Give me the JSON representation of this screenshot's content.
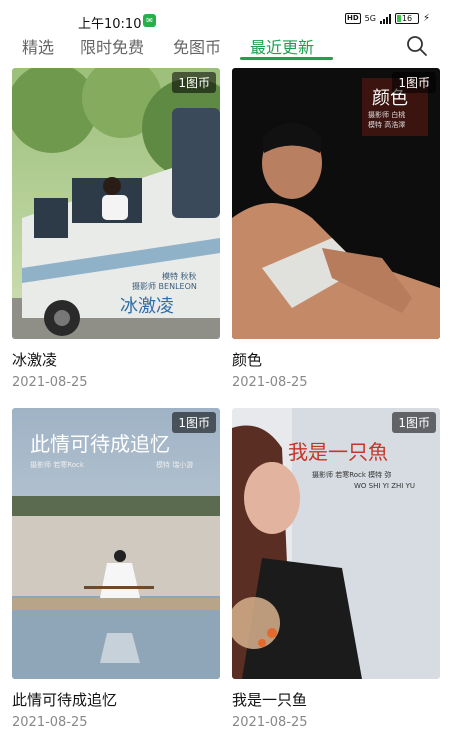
{
  "status_bar": {
    "time": "上午10:10",
    "hd": "HD",
    "network": "5G",
    "battery": "16"
  },
  "tabs": [
    {
      "label": "精选",
      "active": false
    },
    {
      "label": "限时免费",
      "active": false
    },
    {
      "label": "免图币",
      "active": false
    },
    {
      "label": "最近更新",
      "active": true
    }
  ],
  "accent_color": "#1fa04f",
  "cards": [
    {
      "title": "冰激凌",
      "date": "2021-08-25",
      "price": "1图币",
      "cover_title": "冰激凌",
      "cover_credit_line1": "模特  秋秋",
      "cover_credit_line2": "摄影师  BENLEON"
    },
    {
      "title": "颜色",
      "date": "2021-08-25",
      "price": "1图币",
      "cover_title": "颜色",
      "cover_credit_line1": "摄影师  白桃",
      "cover_credit_line2": "模特  高浩澤"
    },
    {
      "title": "此情可待成追忆",
      "date": "2021-08-25",
      "price": "1图币",
      "cover_title": "此情可待成追忆",
      "cover_credit_line1": "摄影师  若寒Rock",
      "cover_credit_line2": "模特  瑞小游"
    },
    {
      "title": "我是一只鱼",
      "date": "2021-08-25",
      "price": "1图币",
      "cover_title": "我是一只魚",
      "cover_credit_line1": "摄影师  若寒Rock    模特  弥",
      "cover_credit_line2": "WO SHI YI ZHI YU"
    }
  ]
}
